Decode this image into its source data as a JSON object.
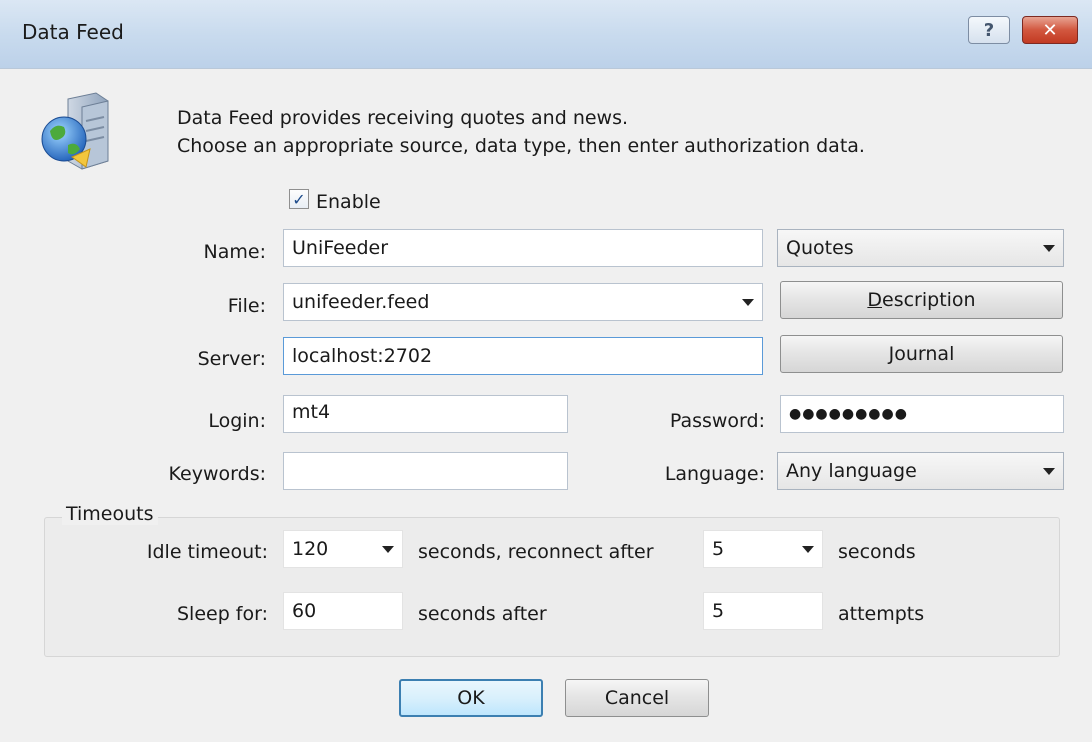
{
  "window": {
    "title": "Data Feed",
    "help_glyph": "?",
    "close_glyph": "✕"
  },
  "header": {
    "icon": "server-globe-icon",
    "line1": "Data Feed provides receiving quotes and news.",
    "line2": "Choose an appropriate source, data type, then enter authorization data."
  },
  "form": {
    "enable": {
      "label": "Enable",
      "checked": true,
      "glyph": "✓"
    },
    "name": {
      "label": "Name:",
      "value": "UniFeeder"
    },
    "type": {
      "value": "Quotes"
    },
    "file": {
      "label": "File:",
      "value": "unifeeder.feed"
    },
    "description_button": {
      "underline": "D",
      "rest": "escription"
    },
    "server": {
      "label": "Server:",
      "value": "localhost:2702"
    },
    "journal_button": {
      "underline": "J",
      "rest": "ournal"
    },
    "login": {
      "label": "Login:",
      "value": "mt4"
    },
    "password": {
      "label": "Password:",
      "value": "●●●●●●●●●"
    },
    "keywords": {
      "label": "Keywords:",
      "value": ""
    },
    "language": {
      "label": "Language:",
      "value": "Any language"
    }
  },
  "timeouts": {
    "title": "Timeouts",
    "idle_label": "Idle timeout:",
    "idle_value": "120",
    "reconnect_text": "seconds, reconnect after",
    "reconnect_value": "5",
    "seconds_text": "seconds",
    "sleep_label": "Sleep for:",
    "sleep_value": "60",
    "seconds_after_text": "seconds after",
    "attempts_value": "5",
    "attempts_text": "attempts"
  },
  "buttons": {
    "ok": "OK",
    "cancel": "Cancel"
  },
  "colors": {
    "title_bar": "#c9dbee",
    "close_button": "#d2573f",
    "default_button_border": "#3c7fb1",
    "focus_border": "#5a9ad8"
  }
}
